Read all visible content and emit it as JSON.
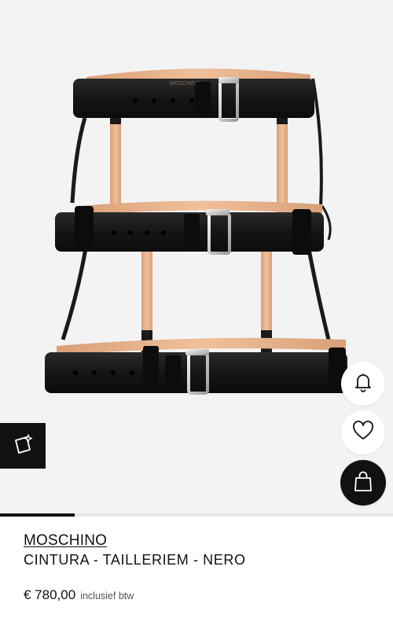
{
  "product": {
    "brand": "MOSCHINO",
    "name": "CINTURA - TAILLERIEM - NERO",
    "price": "€ 780,00",
    "tax_note": "inclusief btw",
    "image_embossed_text": "MOSCHINO"
  },
  "gallery": {
    "progress_fraction": 0.19
  },
  "icons": {
    "style_badge": "sparkle-frame-icon",
    "notify": "bell-icon",
    "wishlist": "heart-icon",
    "bag": "shopping-bag-icon"
  },
  "colors": {
    "accent": "#111111",
    "image_background": "#f3f3f3",
    "belt_leather": "#1a1a1a",
    "belt_lining": "#e8b48c"
  }
}
